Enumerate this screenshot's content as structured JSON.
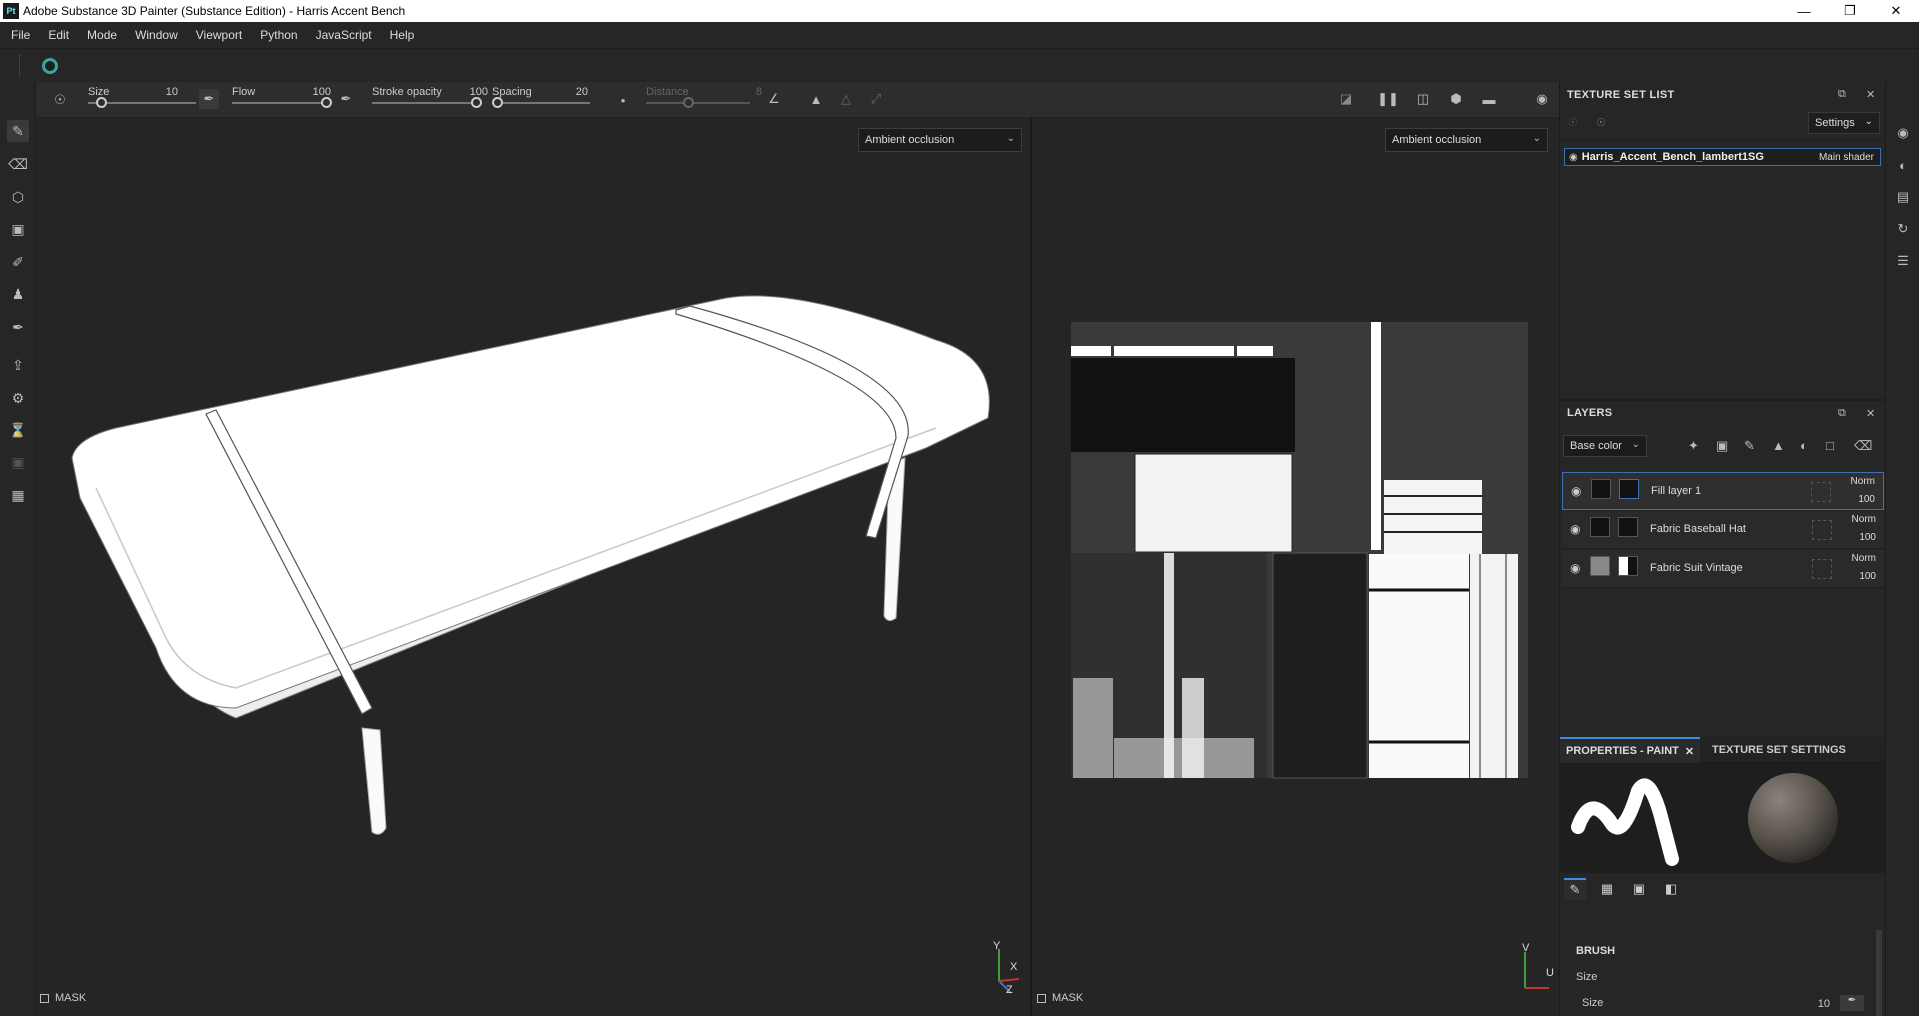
{
  "window": {
    "title": "Adobe Substance 3D Painter (Substance Edition) - Harris Accent Bench",
    "app_badge": "Pt",
    "controls": [
      "minimize-icon",
      "restore-icon",
      "close-icon"
    ]
  },
  "menu": [
    "File",
    "Edit",
    "Mode",
    "Window",
    "Viewport",
    "Python",
    "JavaScript",
    "Help"
  ],
  "toolbar": {
    "size_label": "Size",
    "size_value": "10",
    "size_level": 0.12,
    "flow_label": "Flow",
    "flow_value": "100",
    "flow_level": 1.0,
    "stroke_label": "Stroke opacity",
    "stroke_value": "100",
    "stroke_level": 1.0,
    "spacing_label": "Spacing",
    "spacing_value": "20",
    "spacing_level": 0.05,
    "distance_label": "Distance",
    "distance_value": "8",
    "distance_level": 0.4
  },
  "viewport3d": {
    "channel": "Ambient occlusion",
    "mask_label": "MASK",
    "axes": {
      "y": "Y",
      "x": "X",
      "z": "Z"
    }
  },
  "viewport2d": {
    "channel": "Ambient occlusion",
    "mask_label": "MASK",
    "axes": {
      "v": "V",
      "u": "U"
    }
  },
  "texture_set_list": {
    "title": "TEXTURE SET LIST",
    "settings_label": "Settings",
    "item_name": "Harris_Accent_Bench_lambert1SG",
    "item_shader": "Main shader"
  },
  "layers": {
    "title": "LAYERS",
    "channel": "Base color",
    "items": [
      {
        "name": "Fill layer 1",
        "blend": "Norm",
        "opacity": "100"
      },
      {
        "name": "Fabric Baseball Hat",
        "blend": "Norm",
        "opacity": "100"
      },
      {
        "name": "Fabric Suit Vintage",
        "blend": "Norm",
        "opacity": "100"
      }
    ]
  },
  "properties": {
    "tab_paint": "PROPERTIES - PAINT",
    "tab_texture_set": "TEXTURE SET SETTINGS",
    "section_title": "BRUSH",
    "size_group": "Size",
    "size_label": "Size",
    "size_value": "10"
  },
  "colors": {
    "accent": "#3d8ee0",
    "selection": "#3d6fb3",
    "logo": "#37a7a0"
  }
}
